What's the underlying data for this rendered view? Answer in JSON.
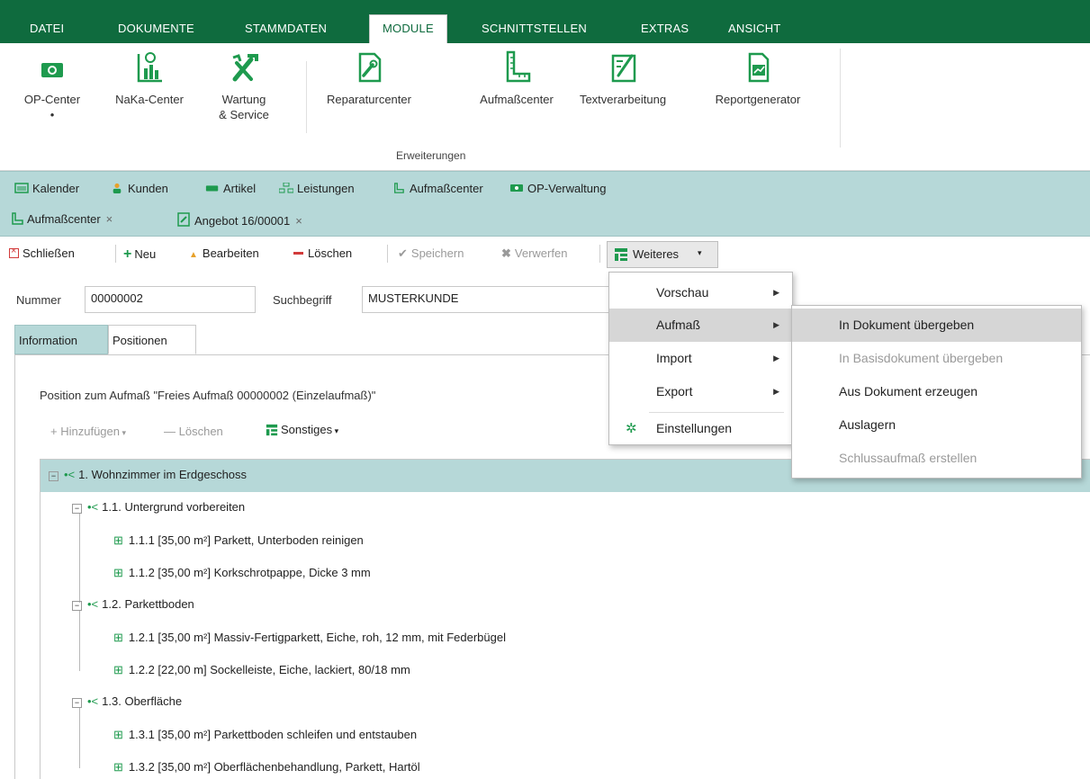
{
  "menubar": {
    "tabs": [
      "DATEI",
      "DOKUMENTE",
      "STAMMDATEN",
      "MODULE",
      "SCHNITTSTELLEN",
      "EXTRAS",
      "ANSICHT"
    ],
    "active": "MODULE",
    "accent_color": "#0f6b3e"
  },
  "ribbon": {
    "buttons": [
      {
        "label": "OP-Center",
        "icon": "op-center-icon",
        "sub": "•"
      },
      {
        "label": "NaKa-Center",
        "icon": "naka-center-icon"
      },
      {
        "label": "Wartung",
        "label2": "& Service",
        "icon": "tools-icon"
      },
      {
        "label": "Reparaturcenter",
        "icon": "repair-doc-icon"
      },
      {
        "label": "Aufmaßcenter",
        "icon": "ruler-icon"
      },
      {
        "label": "Textverarbeitung",
        "icon": "text-edit-icon"
      },
      {
        "label": "Reportgenerator",
        "icon": "report-icon"
      }
    ],
    "group_label": "Erweiterungen"
  },
  "quickbar": {
    "items": [
      {
        "label": "Kalender",
        "icon": "calendar-icon"
      },
      {
        "label": "Kunden",
        "icon": "customers-icon"
      },
      {
        "label": "Artikel",
        "icon": "article-icon"
      },
      {
        "label": "Leistungen",
        "icon": "services-icon"
      },
      {
        "label": "Aufmaßcenter",
        "icon": "ruler-icon"
      },
      {
        "label": "OP-Verwaltung",
        "icon": "op-icon"
      }
    ]
  },
  "doctabs": [
    {
      "label": "Aufmaßcenter",
      "close": "×"
    },
    {
      "label": "Angebot 16/00001",
      "close": "×"
    }
  ],
  "toolbar": {
    "close": "Schließen",
    "new": "Neu",
    "edit": "Bearbeiten",
    "delete": "Löschen",
    "save": "Speichern",
    "discard": "Verwerfen",
    "more": "Weiteres"
  },
  "fields": {
    "nummer_label": "Nummer",
    "nummer_value": "00000002",
    "such_label": "Suchbegriff",
    "such_value": "MUSTERKUNDE"
  },
  "inner_tabs": [
    "Information",
    "Positionen"
  ],
  "content": {
    "heading": "Position zum Aufmaß \"Freies Aufmaß 00000002 (Einzelaufmaß)\"",
    "sub_toolbar": {
      "add": "Hinzufügen",
      "delete": "Löschen",
      "other": "Sonstiges"
    }
  },
  "tree": [
    {
      "level": 0,
      "text": "1. Wohnzimmer im Erdgeschoss",
      "type": "group"
    },
    {
      "level": 1,
      "text": "1.1. Untergrund vorbereiten",
      "type": "group"
    },
    {
      "level": 2,
      "text": "1.1.1  [35,00 m²] Parkett, Unterboden reinigen",
      "type": "item"
    },
    {
      "level": 2,
      "text": "1.1.2  [35,00 m²] Korkschrotpappe, Dicke 3 mm",
      "type": "item"
    },
    {
      "level": 1,
      "text": "1.2. Parkettboden",
      "type": "group"
    },
    {
      "level": 2,
      "text": "1.2.1  [35,00 m²] Massiv-Fertigparkett, Eiche, roh, 12 mm, mit Federbügel",
      "type": "item"
    },
    {
      "level": 2,
      "text": "1.2.2  [22,00 m] Sockelleiste, Eiche, lackiert, 80/18 mm",
      "type": "item"
    },
    {
      "level": 1,
      "text": "1.3. Oberfläche",
      "type": "group"
    },
    {
      "level": 2,
      "text": "1.3.1  [35,00 m²] Parkettboden schleifen und entstauben",
      "type": "item"
    },
    {
      "level": 2,
      "text": "1.3.2  [35,00 m²] Oberflächenbehandlung, Parkett, Hartöl",
      "type": "item"
    }
  ],
  "menu_weiteres": [
    {
      "label": "Vorschau",
      "submenu": true
    },
    {
      "label": "Aufmaß",
      "submenu": true,
      "highlighted": true
    },
    {
      "label": "Import",
      "submenu": true
    },
    {
      "label": "Export",
      "submenu": true
    },
    {
      "label": "Einstellungen",
      "icon": "gear-icon"
    }
  ],
  "menu_aufmass": [
    {
      "label": "In Dokument übergeben",
      "highlighted": true
    },
    {
      "label": "In Basisdokument übergeben",
      "disabled": true
    },
    {
      "label": "Aus Dokument erzeugen"
    },
    {
      "label": "Auslagern"
    },
    {
      "label": "Schlussaufmaß erstellen",
      "disabled": true
    }
  ]
}
